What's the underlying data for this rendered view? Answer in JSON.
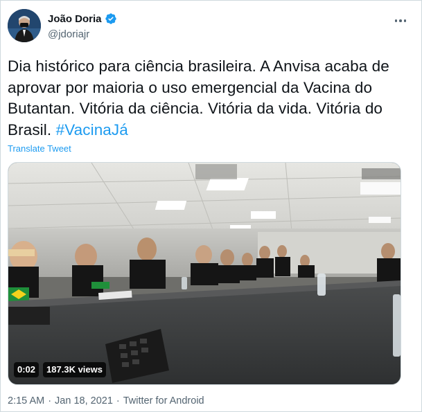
{
  "author": {
    "name": "João Doria",
    "handle": "@jdoriajr",
    "verified": true,
    "avatar_icon": "profile-photo"
  },
  "tweet": {
    "text": "Dia histórico para ciência brasileira. A Anvisa acaba de aprovar por maioria o uso emergencial da Vacina do Butantan. Vitória da ciência. Vitória da vida. Vitória do Brasil.",
    "hashtag": "#VacinaJá",
    "translate_label": "Translate Tweet"
  },
  "media": {
    "type": "video",
    "duration": "0:02",
    "views": "187.3K views"
  },
  "meta": {
    "time": "2:15 AM",
    "separator": "·",
    "date": "Jan 18, 2021",
    "source": "Twitter for Android"
  },
  "colors": {
    "link": "#1d9bf0",
    "secondary_text": "#536471",
    "primary_text": "#0f1419"
  },
  "icons": [
    "verified-badge-icon",
    "more-icon"
  ]
}
